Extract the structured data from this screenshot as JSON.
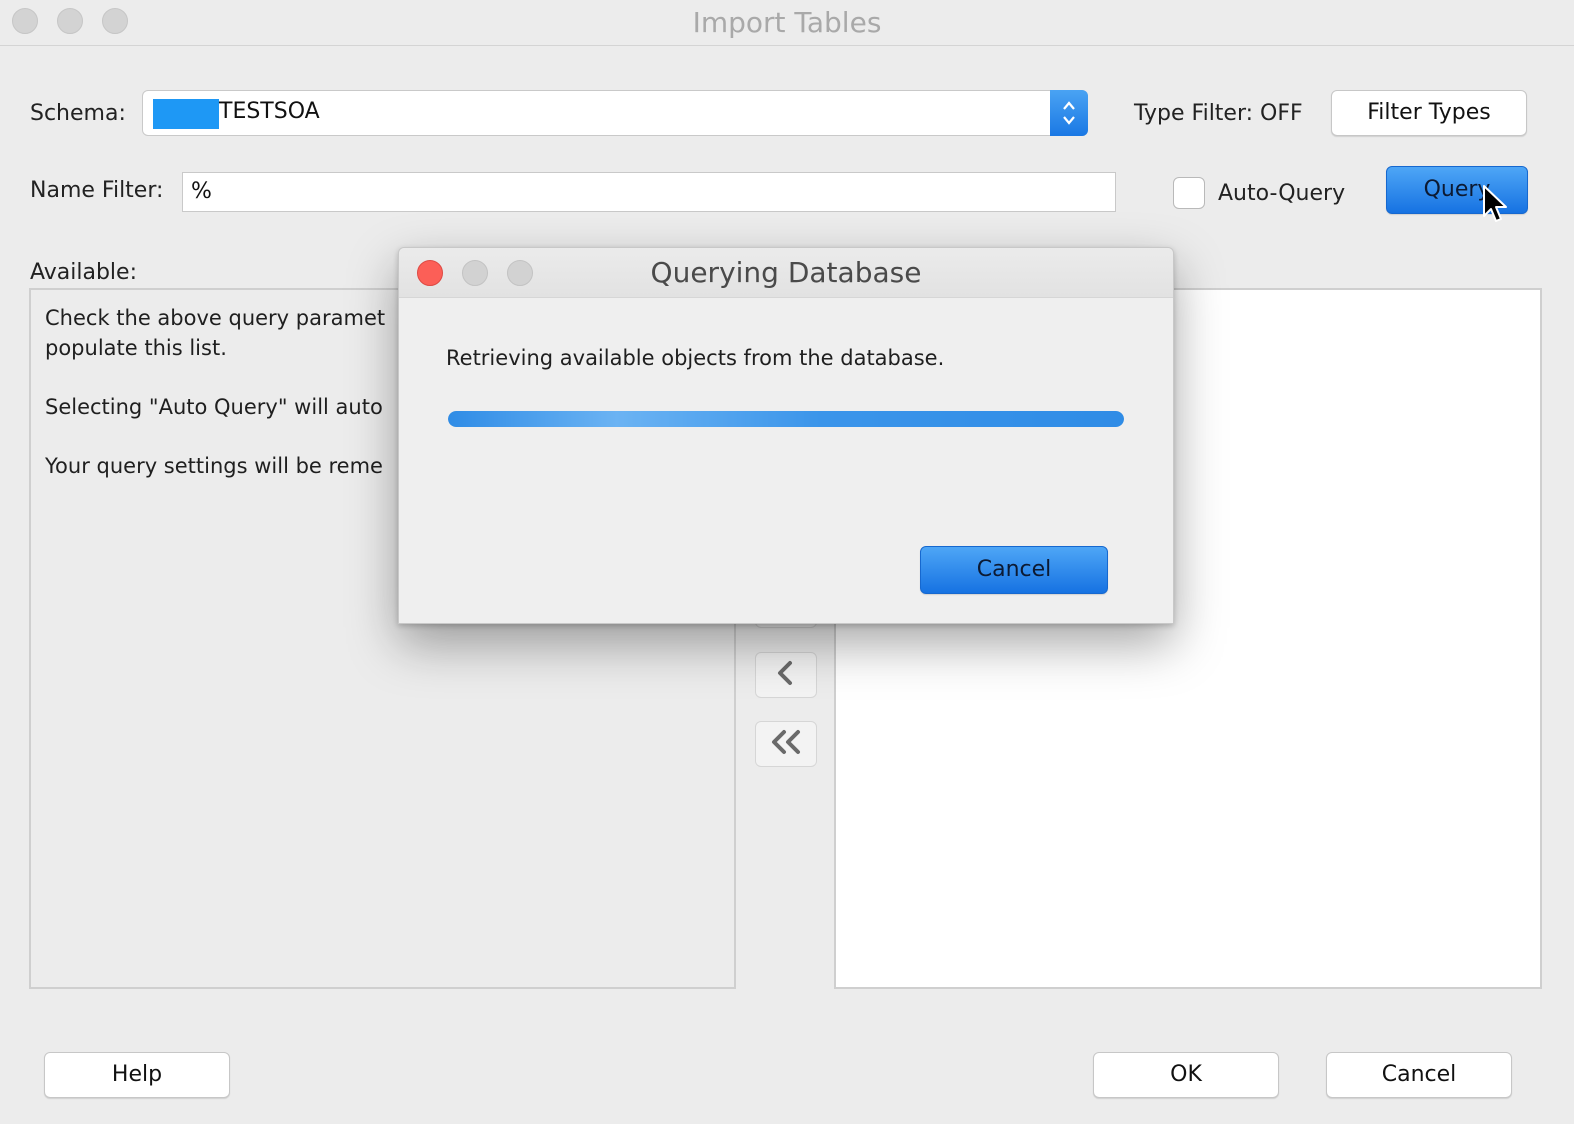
{
  "window": {
    "title": "Import Tables"
  },
  "schema": {
    "label": "Schema:",
    "value": "TESTSOA"
  },
  "type_filter": {
    "label": "Type Filter: OFF",
    "button": "Filter Types"
  },
  "name_filter": {
    "label": "Name Filter:",
    "value": "%"
  },
  "auto_query": {
    "label": "Auto-Query",
    "checked": false
  },
  "query_button": "Query",
  "available": {
    "label": "Available:",
    "help_lines": [
      "Check the above query paramet",
      "populate this list.",
      "Selecting \"Auto Query\" will auto",
      "Your query settings will be reme"
    ]
  },
  "move_buttons": [
    {
      "icon": "chevron-left-icon"
    },
    {
      "icon": "double-chevron-left-icon"
    }
  ],
  "footer": {
    "help": "Help",
    "ok": "OK",
    "cancel": "Cancel"
  },
  "dialog": {
    "title": "Querying Database",
    "message": "Retrieving available objects from the database.",
    "progress": 1.0,
    "cancel": "Cancel"
  },
  "colors": {
    "accent": "#1e7fe8",
    "close_red": "#fc5f57",
    "selection": "#1e98f5"
  }
}
